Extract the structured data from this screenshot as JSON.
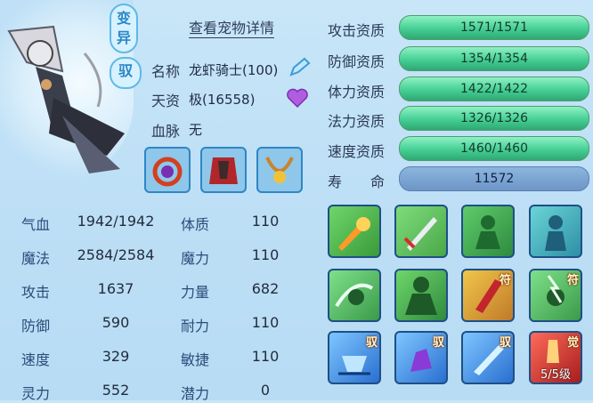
{
  "badges": {
    "variant": "变异",
    "bind": "驭"
  },
  "detail_link": "查看宠物详情",
  "pet": {
    "name_label": "名称",
    "name_value": "龙虾骑士(100)",
    "talent_label": "天资",
    "talent_value": "极(16558)",
    "bloodline_label": "血脉",
    "bloodline_value": "无"
  },
  "stats": [
    {
      "label": "气血",
      "value": "1942/1942",
      "label2": "体质",
      "value2": "110"
    },
    {
      "label": "魔法",
      "value": "2584/2584",
      "label2": "魔力",
      "value2": "110"
    },
    {
      "label": "攻击",
      "value": "1637",
      "label2": "力量",
      "value2": "682"
    },
    {
      "label": "防御",
      "value": "590",
      "label2": "耐力",
      "value2": "110"
    },
    {
      "label": "速度",
      "value": "329",
      "label2": "敏捷",
      "value2": "110"
    },
    {
      "label": "灵力",
      "value": "552",
      "label2": "潜力",
      "value2": "0"
    }
  ],
  "aptitudes": [
    {
      "label": "攻击资质",
      "value": "1571/1571"
    },
    {
      "label": "防御资质",
      "value": "1354/1354"
    },
    {
      "label": "体力资质",
      "value": "1422/1422"
    },
    {
      "label": "法力资质",
      "value": "1326/1326"
    },
    {
      "label": "速度资质",
      "value": "1460/1460"
    }
  ],
  "life": {
    "label": "寿　　命",
    "value": "11572"
  },
  "skill_tags": {
    "fu": "符",
    "yu": "驭",
    "jue": "觉",
    "level": "5/5级"
  },
  "colors": {
    "bar_green": "#45cf95",
    "bar_blue": "#6d96c8",
    "badge_blue": "#2c87c6"
  }
}
